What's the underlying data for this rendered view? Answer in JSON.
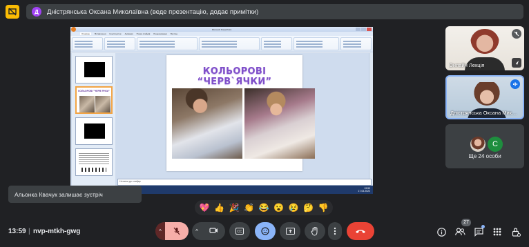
{
  "presenter_banner": {
    "avatar_initial": "Д",
    "text": "Дністрянська Оксана Миколаївна (веде презентацію, додає примітки)"
  },
  "shared_screen": {
    "slide_title": "КОЛЬОРОВІ “ЧЕРВ`ЯЧКИ”",
    "thumbnail_title": "КОЛЬОРОВІ \"ЧЕРВ`ЯЧКИ\"",
    "notes_placeholder": "Нотатки до слайда",
    "ribbon_tabs": [
      "Основне",
      "Вставлення",
      "Конструктор",
      "Анімація",
      "Показ слайдів",
      "Рецензування",
      "Вигляд"
    ],
    "window_title": "Microsoft PowerPoint",
    "tray_time": "13:59",
    "tray_date": "17.03.2022"
  },
  "participants": [
    {
      "label": "Онлайн Лекція",
      "state": "muted"
    },
    {
      "label": "Дністрянська Оксана Миколаївна",
      "state": "speaking"
    }
  ],
  "more_tile": {
    "avatar_letter": "С",
    "label": "Ще 24 особи"
  },
  "toast": "Альонка Квачук залишає зустріч",
  "reactions": [
    "💖",
    "👍",
    "🎉",
    "👏",
    "😂",
    "😮",
    "😢",
    "🤔",
    "👎"
  ],
  "meeting": {
    "time": "13:59",
    "separator": "|",
    "code": "nvp-mtkh-gwg"
  },
  "people_count": "27",
  "colors": {
    "leave": "#ea4335",
    "emoji_active": "#8ab4f8",
    "mic_off": "#f6aea9",
    "warning": "#fbbc04"
  }
}
